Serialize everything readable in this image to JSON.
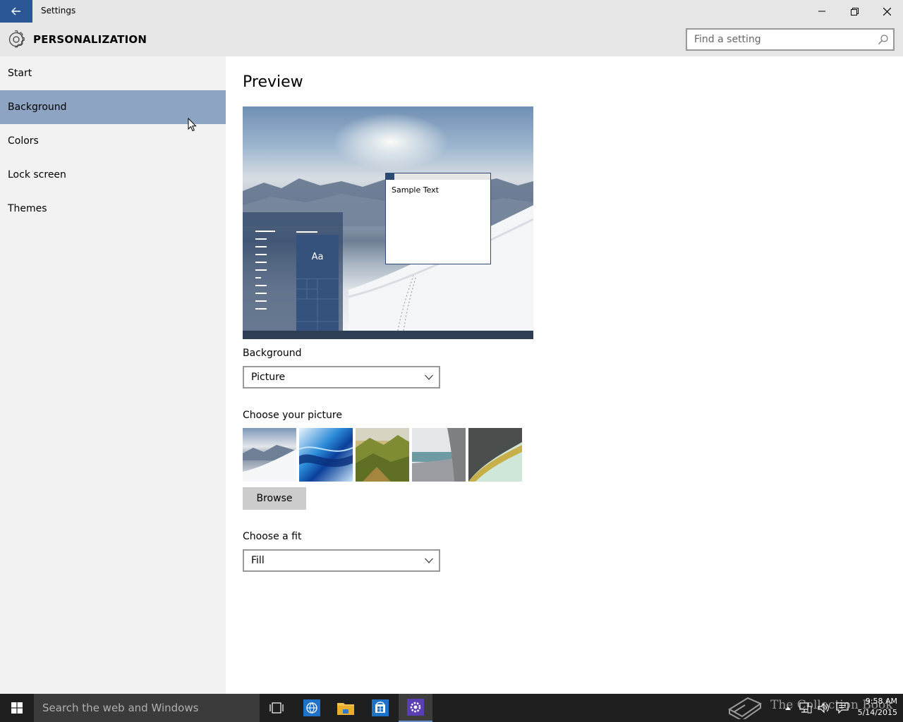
{
  "window": {
    "title": "Settings",
    "minimize_icon": "minimize-icon",
    "restore_icon": "restore-icon",
    "close_icon": "close-icon"
  },
  "header": {
    "title": "PERSONALIZATION",
    "search_placeholder": "Find a setting"
  },
  "sidebar": {
    "items": [
      {
        "label": "Start",
        "active": false
      },
      {
        "label": "Background",
        "active": true
      },
      {
        "label": "Colors",
        "active": false
      },
      {
        "label": "Lock screen",
        "active": false
      },
      {
        "label": "Themes",
        "active": false
      }
    ]
  },
  "main": {
    "preview_heading": "Preview",
    "preview": {
      "tile_text": "Aa",
      "sample_text": "Sample Text"
    },
    "background_label": "Background",
    "background_value": "Picture",
    "choose_picture_label": "Choose your picture",
    "pictures": [
      "snowy-mountain",
      "blue-abstract",
      "green-hills",
      "coastal-cliff",
      "sand-shore"
    ],
    "browse_label": "Browse",
    "fit_label": "Choose a fit",
    "fit_value": "Fill"
  },
  "taskbar": {
    "search_text": "Search the web and Windows",
    "watermark": "The Collection Book",
    "time": "9:58 AM",
    "date": "5/14/2015"
  },
  "colors": {
    "accent": "#2b5797",
    "sidebar_active": "#8ea4c3",
    "titlebar_bg": "#e6e6e6",
    "sidebar_bg": "#f2f2f2",
    "taskbar_bg": "#1f1f1f"
  }
}
